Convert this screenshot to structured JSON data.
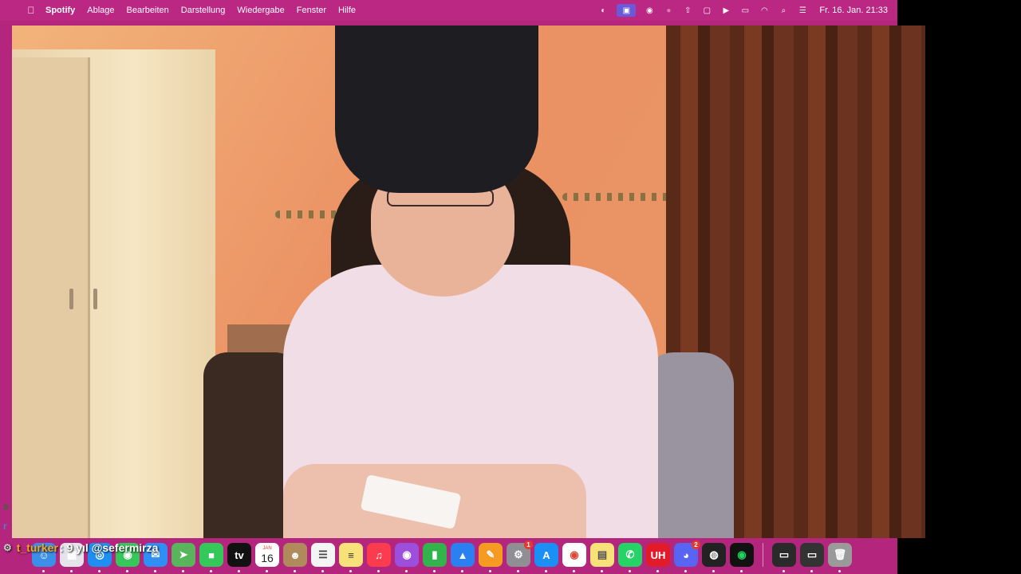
{
  "menubar": {
    "app_name": "Spotify",
    "menus": [
      "Ablage",
      "Bearbeiten",
      "Darstellung",
      "Wiedergabe",
      "Fenster",
      "Hilfe"
    ],
    "status_icons": [
      "creative-cloud-icon",
      "screen-share-icon",
      "eye-icon",
      "record-icon",
      "airplay-icon",
      "window-icon",
      "play-icon",
      "battery-icon",
      "wifi-icon",
      "search-icon",
      "control-center-icon"
    ],
    "clock": "Fr. 16. Jan.  21:33"
  },
  "colors": {
    "desktop": "#b4257e",
    "menubar": "#bb2883",
    "chat_username": "#f5a623"
  },
  "dock": {
    "apps": [
      {
        "name": "finder-icon",
        "color": "#3b8fe8",
        "glyph": "☺"
      },
      {
        "name": "launchpad-icon",
        "color": "#e4e4ea",
        "glyph": "▦"
      },
      {
        "name": "safari-icon",
        "color": "#1e8ff0",
        "glyph": "◎"
      },
      {
        "name": "messages-icon",
        "color": "#35c759",
        "glyph": "◉"
      },
      {
        "name": "mail-icon",
        "color": "#2f8ff5",
        "glyph": "✉"
      },
      {
        "name": "maps-icon",
        "color": "#59b55c",
        "glyph": "➤"
      },
      {
        "name": "facetime-icon",
        "color": "#34c759",
        "glyph": "■"
      },
      {
        "name": "appletv-icon",
        "color": "#111111",
        "glyph": "tv"
      },
      {
        "name": "calendar-icon",
        "calendar": true,
        "month": "JAN",
        "day": "16"
      },
      {
        "name": "contacts-icon",
        "color": "#b08a5a",
        "glyph": "☻"
      },
      {
        "name": "reminders-icon",
        "color": "#f4f4f4",
        "glyph": "☰",
        "fg": "#444"
      },
      {
        "name": "notes-icon",
        "color": "#f7e27a",
        "glyph": "≡",
        "fg": "#333"
      },
      {
        "name": "music-icon",
        "color": "#fb3b4e",
        "glyph": "♫"
      },
      {
        "name": "podcasts-icon",
        "color": "#9b4fdc",
        "glyph": "◉"
      },
      {
        "name": "numbers-icon",
        "color": "#33b34b",
        "glyph": "▮"
      },
      {
        "name": "keynote-icon",
        "color": "#2a7ff1",
        "glyph": "▲"
      },
      {
        "name": "pages-icon",
        "color": "#f59b22",
        "glyph": "✎"
      },
      {
        "name": "system-settings-icon",
        "color": "#8e8e93",
        "glyph": "⚙",
        "badge": "1"
      },
      {
        "name": "app-store-icon",
        "color": "#1a8ff5",
        "glyph": "A"
      },
      {
        "name": "chrome-icon",
        "color": "#ffffff",
        "glyph": "◉",
        "fg": "#db4437"
      },
      {
        "name": "stickies-icon",
        "color": "#f7e27a",
        "glyph": "▤",
        "fg": "#555"
      },
      {
        "name": "whatsapp-icon",
        "color": "#25d366",
        "glyph": "✆"
      },
      {
        "name": "uhh-app-icon",
        "color": "#e21b2b",
        "glyph": "UH"
      },
      {
        "name": "discord-icon",
        "color": "#5865f2",
        "glyph": "◕",
        "badge": "2"
      },
      {
        "name": "obs-icon",
        "color": "#222222",
        "glyph": "◍"
      },
      {
        "name": "spotify-icon",
        "color": "#111111",
        "glyph": "◉",
        "fg": "#1ed760"
      }
    ],
    "recent": [
      {
        "name": "recent-window-1-icon",
        "color": "#2a2a2a",
        "glyph": "▭"
      },
      {
        "name": "recent-window-2-icon",
        "color": "#333333",
        "glyph": "▭"
      },
      {
        "name": "trash-icon",
        "color": "#9a9a9a",
        "glyph": "🗑"
      }
    ]
  },
  "chat": {
    "username": "t_turker",
    "separator": ":",
    "message": "9 yıl @sefermirza",
    "side_fragment_1": "s",
    "side_fragment_2": "r"
  }
}
